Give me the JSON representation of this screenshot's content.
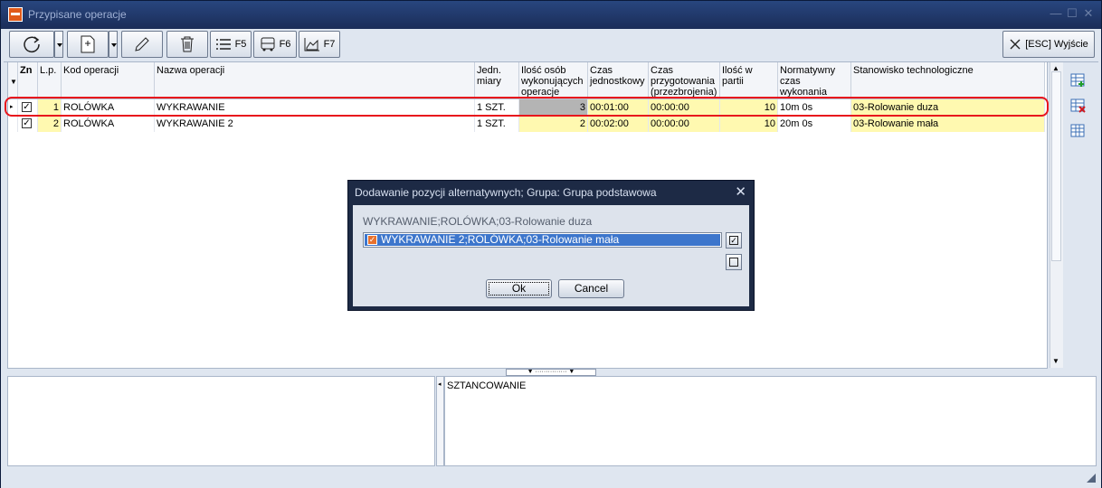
{
  "window": {
    "title": "Przypisane operacje",
    "minimize": "—",
    "maximize": "☐",
    "close": "✕"
  },
  "toolbar": {
    "f5_label": "F5",
    "f6_label": "F6",
    "f7_label": "F7",
    "exit_label": "[ESC] Wyjście"
  },
  "grid": {
    "columns": [
      "Zn",
      "L.p.",
      "Kod operacji",
      "Nazwa operacji",
      "Jedn. miary",
      "Ilość osób wykonujących operacje",
      "Czas jednostkowy",
      "Czas przygotowania (przezbrojenia)",
      "Ilość w partii",
      "Normatywny czas wykonania partii",
      "Stanowisko technologiczne"
    ],
    "rows": [
      {
        "checked": "✓",
        "lp": "1",
        "kod": "ROLÓWKA",
        "nazwa": "WYKRAWANIE",
        "jm": "1 SZT.",
        "osoby": "3",
        "czas_j": "00:01:00",
        "czas_p": "00:00:00",
        "partia": "10",
        "norm": "10m 0s",
        "stanowisko": "03-Rolowanie duza"
      },
      {
        "checked": "✓",
        "lp": "2",
        "kod": "ROLÓWKA",
        "nazwa": "WYKRAWANIE 2",
        "jm": "1 SZT.",
        "osoby": "2",
        "czas_j": "00:02:00",
        "czas_p": "00:00:00",
        "partia": "10",
        "norm": "20m 0s",
        "stanowisko": "03-Rolowanie mała"
      }
    ]
  },
  "bottom": {
    "right_text": "SZTANCOWANIE"
  },
  "dialog": {
    "title": "Dodawanie pozycji alternatywnych; Grupa: Grupa podstawowa",
    "subtitle": "WYKRAWANIE;ROLÓWKA;03-Rolowanie duza",
    "items": [
      {
        "label": "WYKRAWANIE 2;ROLÓWKA;03-Rolowanie mała",
        "checked": "✓"
      }
    ],
    "select_all_glyph": "✓",
    "ok_label": "Ok",
    "cancel_label": "Cancel"
  },
  "colors": {
    "highlight_row": "#fff9b0",
    "selection": "#3d76cc",
    "annotation": "#e8141c"
  }
}
